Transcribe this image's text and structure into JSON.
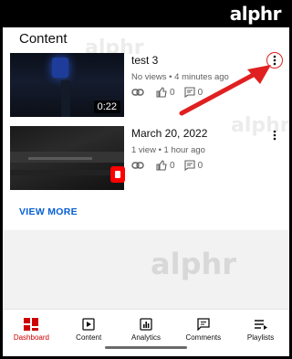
{
  "brand": "alphr",
  "section_title": "Content",
  "videos": [
    {
      "title": "test 3",
      "meta": "No views • 4 minutes ago",
      "duration": "0:22",
      "likes": "0",
      "comments": "0"
    },
    {
      "title": "March 20, 2022",
      "meta": "1 view • 1 hour ago",
      "likes": "0",
      "comments": "0"
    }
  ],
  "view_more": "VIEW MORE",
  "watermark": "alphr",
  "nav": [
    {
      "label": "Dashboard",
      "icon": "dashboard-icon",
      "active": true
    },
    {
      "label": "Content",
      "icon": "content-icon",
      "active": false
    },
    {
      "label": "Analytics",
      "icon": "analytics-icon",
      "active": false
    },
    {
      "label": "Comments",
      "icon": "comments-icon",
      "active": false
    },
    {
      "label": "Playlists",
      "icon": "playlists-icon",
      "active": false
    }
  ],
  "colors": {
    "accent_red": "#cc0000",
    "link_blue": "#065fd4",
    "annotation_red": "#e02020"
  }
}
